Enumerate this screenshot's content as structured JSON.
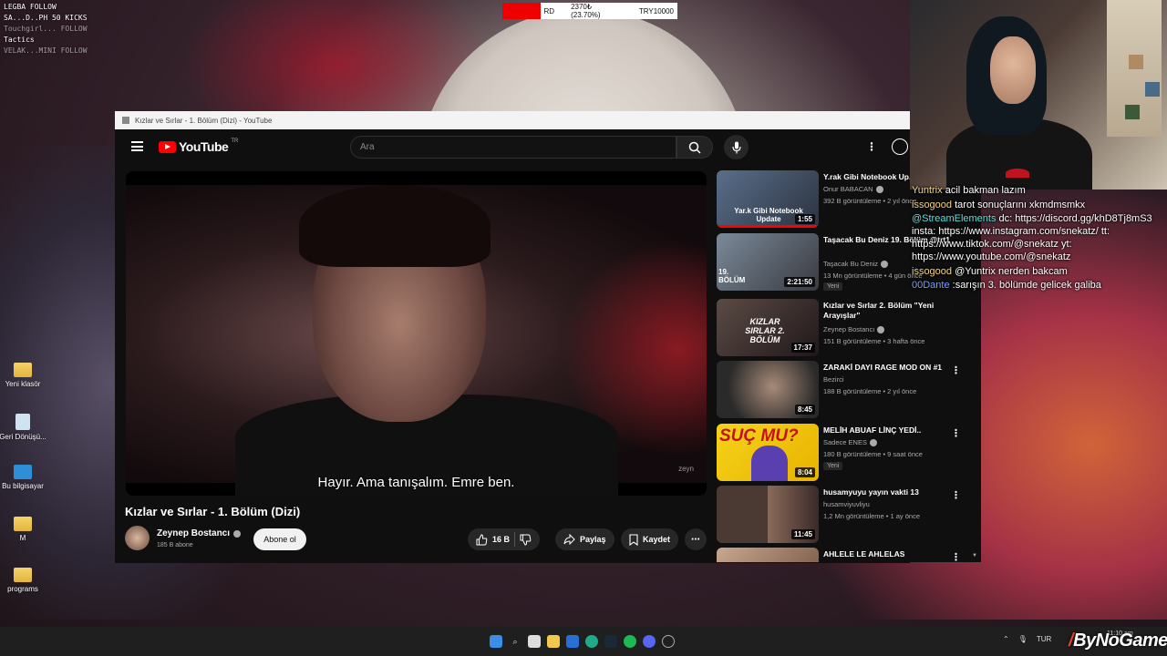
{
  "overlay": {
    "line1": "LEGBA FOLLOW",
    "line2": "SA...D..PH 50 KICKS",
    "line3": "Tactics",
    "line4": "Touchgirl... FOLLOW",
    "line5": "VELAK...MINI FOLLOW"
  },
  "ticker": {
    "left": "RD",
    "mid": "2370₺ (23.70%)",
    "right": "TRY10000"
  },
  "desktop": {
    "icons": [
      {
        "label": "Yeni klasör",
        "icon": "folder-icon"
      },
      {
        "label": "Geri Dönüşü...",
        "icon": "recycle-bin-icon"
      },
      {
        "label": "Bu bilgisayar",
        "icon": "computer-icon"
      },
      {
        "label": "M",
        "icon": "folder-icon"
      },
      {
        "label": "programs",
        "icon": "folder-icon"
      }
    ]
  },
  "window": {
    "title": "Kızlar ve Sırlar - 1. Bölüm (Dizi) - YouTube"
  },
  "header": {
    "logo_text": "YouTube",
    "logo_region": "TR",
    "search_placeholder": "Ara"
  },
  "video": {
    "subtitle": "Hayır. Ama tanışalım. Emre ben.",
    "watermark": "zeyn",
    "title": "Kızlar ve Sırlar - 1. Bölüm (Dizi)",
    "channel": "Zeynep Bostancı",
    "subscribers": "185 B abone",
    "subscribe_label": "Abone ol",
    "likes": "16 B",
    "share_label": "Paylaş",
    "save_label": "Kaydet"
  },
  "recommendations": [
    {
      "title": "Y.rak Gibi Notebook Up...",
      "thumb_text": "Yar.k Gibi Notebook Update",
      "channel": "Onur BABACAN",
      "verified": true,
      "meta": "392 B görüntüleme • 2 yıl önce",
      "duration": "1:55",
      "badge": "",
      "progress": 1.0
    },
    {
      "title": "Taşacak Bu Deniz 19. Bölüm @trt1",
      "thumb_text": "19. BÖLÜM",
      "channel": "Taşacak Bu Deniz",
      "verified": true,
      "meta": "13 Mn görüntüleme • 4 gün önce",
      "duration": "2:21:50",
      "badge": "Yeni",
      "progress": 0
    },
    {
      "title": "Kızlar ve Sırlar 2. Bölüm \"Yeni Arayışlar\"",
      "thumb_text": "KIZLAR SIRLAR 2. BÖLÜM",
      "channel": "Zeynep Bostancı",
      "verified": true,
      "meta": "151 B görüntüleme • 3 hafta önce",
      "duration": "17:37",
      "badge": "",
      "progress": 0
    },
    {
      "title": "ZARAKİ DAYI RAGE MOD ON #1",
      "thumb_text": "",
      "channel": "Bezirci",
      "verified": false,
      "meta": "188 B görüntüleme • 2 yıl önce",
      "duration": "8:45",
      "badge": "",
      "progress": 0
    },
    {
      "title": "MELİH ABUAF LİNÇ YEDİ..",
      "thumb_text": "SUÇ MU?",
      "channel": "Sadece ENES",
      "verified": true,
      "meta": "180 B görüntüleme • 9 saat önce",
      "duration": "8:04",
      "badge": "Yeni",
      "progress": 0
    },
    {
      "title": "husamyuyu yayın vakti 13",
      "thumb_text": "",
      "channel": "husamviyuvliyu",
      "verified": false,
      "meta": "1,2 Mn görüntüleme • 1 ay önce",
      "duration": "11:45",
      "badge": "",
      "progress": 0
    },
    {
      "title": "AHLELE LE AHLELAS",
      "thumb_text": "",
      "channel": "",
      "verified": false,
      "meta": "",
      "duration": "",
      "badge": "",
      "progress": 0
    }
  ],
  "chat": [
    {
      "user": "Yuntrix",
      "text": "acil bakman lazım"
    },
    {
      "user": "issogood",
      "text": "tarot sonuçlarını xkmdmsmkx"
    },
    {
      "user": "@StreamElements",
      "text": "dc: https://discord.gg/khD8Tj8mS3 insta: https://www.instagram.com/snekatz/ tt: https://www.tiktok.com/@snekatz yt: https://www.youtube.com/@snekatz"
    },
    {
      "user": "issogood",
      "text": "@Yuntrix nerden bakcam"
    },
    {
      "user": "00Dante",
      "text": ":sarışın 3. bölümde gelicek galiba"
    }
  ],
  "taskbar": {
    "lang": "TUR",
    "clock": "11:10 am"
  },
  "brand": {
    "logo": "ByNoGame"
  }
}
